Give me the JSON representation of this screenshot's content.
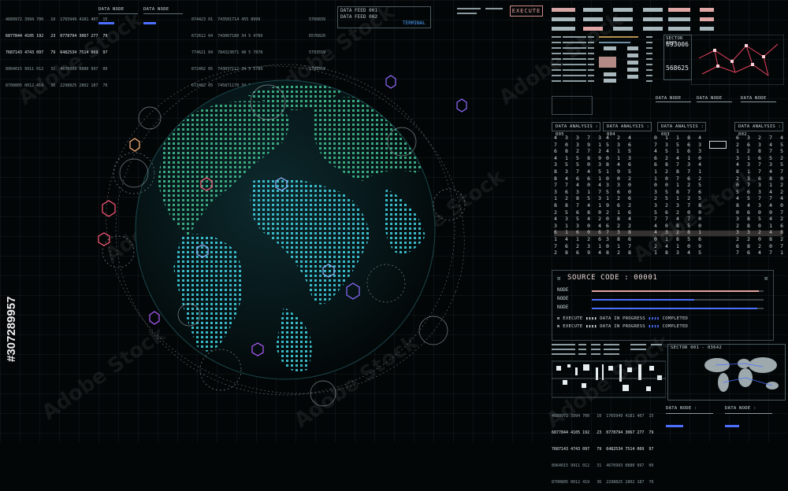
{
  "execute_label": "EXECUTE",
  "terminal_label": "TERMINAL",
  "data_feed_1": "DATA FEED 001",
  "data_feed_2": "DATA FEED 002",
  "data_node_label": "DATA NODE",
  "data_node_colon": "DATA NODE :",
  "sector_0005": "SECTOR 0005",
  "sector_0005_num1": "693006",
  "sector_0005_num2": "568625",
  "sector_001": "SECTOR 001 - 03642",
  "data_analysis_headers": [
    "DATA ANALYSIS : 005",
    "DATA ANALYSIS : 004",
    "DATA ANALYSIS : 003",
    "DATA ANALYSIS : 002"
  ],
  "source_code_title": "SOURCE CODE : 00001",
  "node_label": "NODE",
  "execute_rows": [
    {
      "label": "EXECUTE",
      "mid": "DATA IN PROGRESS",
      "end": "COMPLETED"
    },
    {
      "label": "EXECUTE",
      "mid": "DATA IN PROGRESS",
      "end": "COMPLETED"
    }
  ],
  "top_left_numbers": [
    "4689972 3994 700   10  1765949 4181 407  15",
    "6877844 4105 192   23  0778794 3067 277  79",
    "7687143 4743 097   79  6482534 7514 069  97",
    "8964015 9911 012   31  4676993 0880 997  00",
    "8700805 0012 419   36  2298825 2802 187  70"
  ],
  "bottom_numbers": [
    "4689972 3994 700   10  1765949 4181 407  15",
    "6877844 4105 192   23  0778794 3067 277  79",
    "7687143 4743 097   79  6482534 7514 069  97",
    "8964015 9911 012   31  4676993 0880 997  00",
    "8700805 0012 419   36  2298825 2802 187  70"
  ],
  "mid_numbers": [
    "074423 01  743501714 455 8999",
    "672612 04  743067180 34 5 4789",
    "774621 04  784323071 48 5 7878",
    "672402 05  743037112 34 5 5789",
    "672402 05  745871170 34 5 4789"
  ],
  "right_numbers": [
    "5760839",
    "6576820",
    "5793559",
    "5793559"
  ],
  "matrix_cols": [
    "4 3 3 7 3\n7 0 3 9 1\n6 8 2 7 2\n4 1 5 8 9\n3 5 5 0 3\n8 3 7 4 5\n8 4 6 6 1\n7 7 4 0 4\n3 6 3 1 7\n1 2 8 5 3\n8 8 7 4 1\n2 5 6 8 0\n4 3 5 4 2\n3 1 3 0 4\n6 1 6 0 6\n1 4 1 2 6\n7 6 2 3 1\n2 8 6 9 4",
    "4 2 4\n5 3 6\n4 1 5\n0 1 3\n8 4 6\n1 9 5\n0 0 2\n3 3 0\n5 6 0\n1 2 6\n9 6 2\n2 1 6\n0 8 4\n6 2 2\n7 3 8\n3 8 6\n0 1 7\n8 2 8",
    "0 1 1 8 4\n7 3 5 6 3\n4 5 1 6 3\n6 2 4 1 0\n6 8 7 3 4\n1 2 8 7 1\n1 0 7 6 2\n0 0 1 2 5\n3 5 8 7 6\n2 5 1 2 5\n3 2 3 7 8\n5 6 2 0 0\n7 7 4 7 0\n4 0 8 5 0\n4 3 2 8 1\n0 1 8 5 6\n2 4 1 0 9\n1 8 3 4 5",
    "6 3 2 7 4\n2 6 3 4 5\n1 2 8 7 5\n3 1 6 5 2\n4 3 7 3 5\n8 1 7 4 7\n2 3 6 8 0\n0 7 3 1 2\n5 6 3 4 2\n4 5 7 7 4\n8 4 3 4 0\n0 6 0 0 7\n3 8 5 4 2\n2 8 0 1 6\n3 3 2 4 8\n2 2 0 8 2\n6 8 2 0 7\n7 6 4 7 1"
  ],
  "stock_id": "#307289957",
  "watermark": "Adobe Stock",
  "colors": {
    "globe_cyan": "#43d6e6",
    "globe_green": "#3fb88a",
    "accent_blue": "#4d6fff",
    "accent_salmon": "#e6a49e",
    "accent_pink": "#ff5a7a"
  }
}
